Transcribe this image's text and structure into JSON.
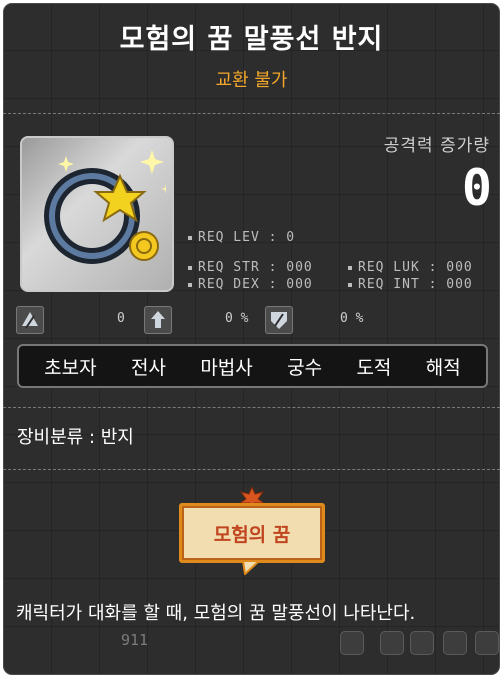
{
  "item": {
    "name": "모험의 꿈 말풍선 반지",
    "trade_status": "교환 불가",
    "attack_increase_label": "공격력 증가량",
    "attack_increase_value": "0"
  },
  "requirements": {
    "lev": "REQ LEV :   0",
    "str": "REQ STR : 000",
    "dex": "REQ DEX : 000",
    "luk": "REQ LUK : 000",
    "int": "REQ INT : 000"
  },
  "stats": {
    "first_value": "0",
    "second_value": "0 %",
    "third_value": "0 %"
  },
  "jobs": [
    "초보자",
    "전사",
    "마법사",
    "궁수",
    "도적",
    "해적"
  ],
  "category": "장비분류 : 반지",
  "badge_label": "모험의 꿈",
  "description": "캐릭터가 대화를 할 때, 모험의 꿈 말풍선이 나타난다.",
  "background_number": "911",
  "colors": {
    "title": "#ffffff",
    "trade_status": "#f3a72a",
    "badge_text": "#c0441e",
    "badge_border": "#e08a1c"
  }
}
